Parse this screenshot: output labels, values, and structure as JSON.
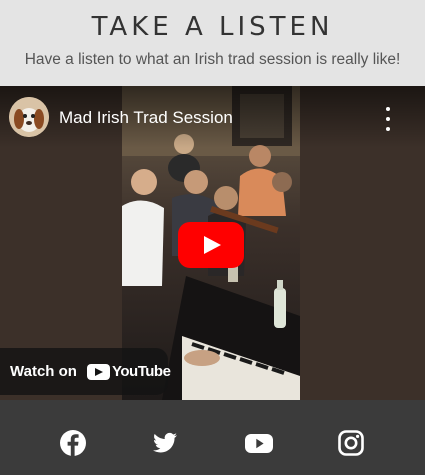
{
  "hero": {
    "title": "TAKE A LISTEN",
    "subtitle": "Have a listen to what an Irish trad session is really like!"
  },
  "video": {
    "title": "Mad Irish Trad Session",
    "watch_on_label": "Watch on",
    "youtube_wordmark": "YouTube",
    "play_button": "play-icon",
    "menu_button": "more-vert-icon",
    "colors": {
      "play": "#ff0000",
      "overlay": "#141414"
    }
  },
  "footer": {
    "links": [
      {
        "icon": "facebook-icon"
      },
      {
        "icon": "twitter-icon"
      },
      {
        "icon": "youtube-icon"
      },
      {
        "icon": "instagram-icon"
      }
    ],
    "colors": {
      "background": "#3b3b3b",
      "icon": "#ffffff"
    }
  }
}
